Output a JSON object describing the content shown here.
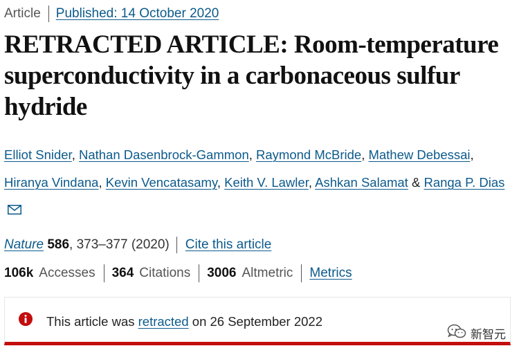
{
  "header": {
    "article_type": "Article",
    "published": "Published: 14 October 2020"
  },
  "title": "RETRACTED ARTICLE: Room-temperature superconductivity in a carbonaceous sulfur hydride",
  "authors": [
    "Elliot Snider",
    "Nathan Dasenbrock-Gammon",
    "Raymond McBride",
    "Mathew Debessai",
    "Hiranya Vindana",
    "Kevin Vencatasamy",
    "Keith V. Lawler",
    "Ashkan Salamat",
    "Ranga P. Dias"
  ],
  "author_separators": {
    "comma": ", ",
    "and": " & "
  },
  "citation": {
    "journal": "Nature",
    "volume": "586",
    "pages_year": ", 373–377 (2020)",
    "cite_link": "Cite this article"
  },
  "metrics": {
    "accesses_value": "106k",
    "accesses_label": "Accesses",
    "citations_value": "364",
    "citations_label": "Citations",
    "altmetric_value": "3006",
    "altmetric_label": "Altmetric",
    "metrics_link": "Metrics"
  },
  "notice": {
    "prefix": "This article was ",
    "link": "retracted",
    "suffix": " on 26 September 2022"
  },
  "watermark": {
    "text": "新智元",
    "icon": "wechat-icon"
  },
  "colors": {
    "link": "#0c5a8c",
    "alert": "#c40d0d"
  }
}
